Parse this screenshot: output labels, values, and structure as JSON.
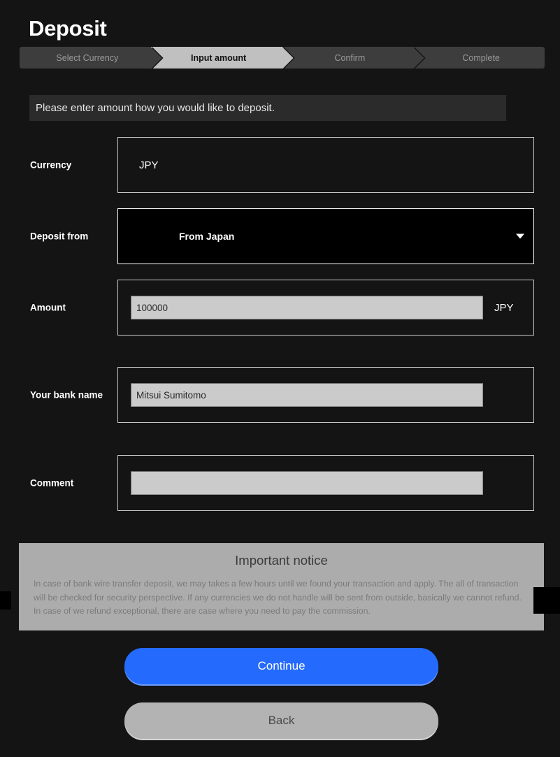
{
  "page": {
    "title": "Deposit"
  },
  "stepper": {
    "steps": [
      {
        "label": "Select Currency",
        "state": "done"
      },
      {
        "label": "Input amount",
        "state": "active"
      },
      {
        "label": "Confirm",
        "state": "upcoming"
      },
      {
        "label": "Complete",
        "state": "upcoming"
      }
    ]
  },
  "instruction": {
    "text": "Please enter amount how you would like to deposit."
  },
  "form": {
    "currency": {
      "label": "Currency",
      "value": "JPY"
    },
    "deposit_from": {
      "label": "Deposit from",
      "value": "From Japan",
      "caret_icon": "chevron-down-icon"
    },
    "amount": {
      "label": "Amount",
      "value": "100000",
      "placeholder": "",
      "unit": "JPY"
    },
    "bank_name": {
      "label": "Your bank name",
      "value": "Mitsui Sumitomo",
      "placeholder": ""
    },
    "comment": {
      "label": "Comment",
      "value": "",
      "placeholder": ""
    }
  },
  "notice": {
    "title": "Important notice",
    "body": "In case of bank wire transfer deposit, we may takes a few hours until we found your transaction and apply. The all of transaction will be checked for security perspective. If any currencies we do not handle will be sent from outside, basically we cannot refund. In case of we refund exceptional, there are case where you need to pay the commission."
  },
  "actions": {
    "continue_label": "Continue",
    "back_label": "Back"
  },
  "colors": {
    "background": "#141414",
    "accent_blue": "#246bfd",
    "step_active": "#c0c0c0",
    "step_inactive": "#3d3d3d",
    "notice_bg": "#acacac",
    "input_bg": "#cbcbcb"
  }
}
